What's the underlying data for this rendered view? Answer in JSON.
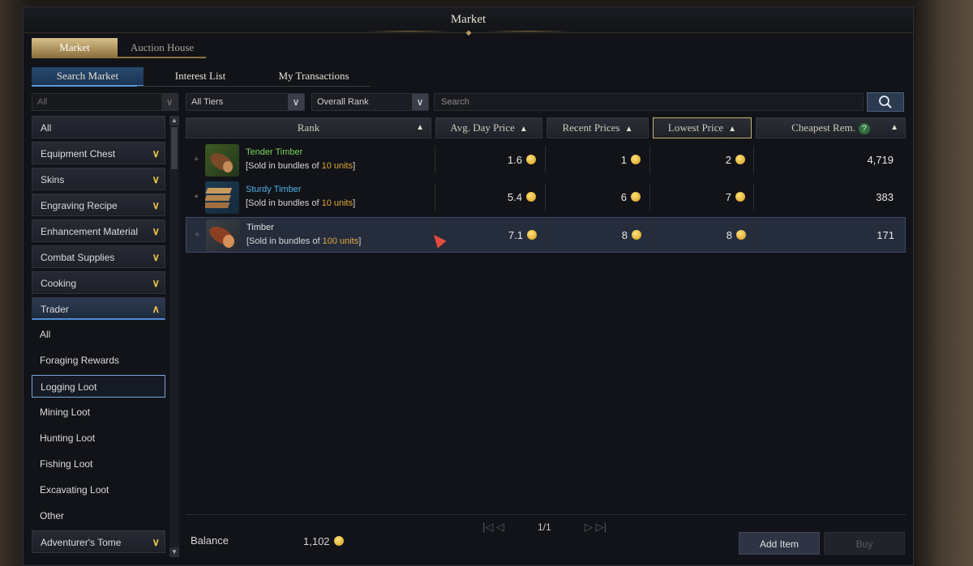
{
  "corner_label": "",
  "window": {
    "title": "Market"
  },
  "main_tabs": [
    "Market",
    "Auction House"
  ],
  "sub_tabs": [
    "Search Market",
    "Interest List",
    "My Transactions"
  ],
  "filters": {
    "category": "All",
    "tier": "All Tiers",
    "rank": "Overall Rank",
    "search_placeholder": "Search"
  },
  "sidebar": [
    {
      "label": "All"
    },
    {
      "label": "Equipment Chest"
    },
    {
      "label": "Skins"
    },
    {
      "label": "Engraving Recipe"
    },
    {
      "label": "Enhancement Material"
    },
    {
      "label": "Combat Supplies"
    },
    {
      "label": "Cooking"
    },
    {
      "label": "Trader"
    },
    {
      "label": "All"
    },
    {
      "label": "Foraging Rewards"
    },
    {
      "label": "Logging Loot"
    },
    {
      "label": "Mining Loot"
    },
    {
      "label": "Hunting Loot"
    },
    {
      "label": "Fishing Loot"
    },
    {
      "label": "Excavating Loot"
    },
    {
      "label": "Other"
    },
    {
      "label": "Adventurer's Tome"
    }
  ],
  "selected_category": "Logging Loot",
  "columns": [
    "Rank",
    "Avg. Day Price",
    "Recent Prices",
    "Lowest Price",
    "Cheapest Rem."
  ],
  "items": [
    {
      "name": "Tender Timber",
      "desc_prefix": "[Sold in bundles of ",
      "bundle": "10 units",
      "desc_suffix": "]",
      "avg_day_price": "1.6",
      "recent_price": "1",
      "lowest_price": "2",
      "cheapest_rem": "4,719",
      "name_color": "#7cd35a"
    },
    {
      "name": "Sturdy Timber",
      "desc_prefix": "[Sold in bundles of ",
      "bundle": "10 units",
      "desc_suffix": "]",
      "avg_day_price": "5.4",
      "recent_price": "6",
      "lowest_price": "7",
      "cheapest_rem": "383",
      "name_color": "#4fb2e6"
    },
    {
      "name": "Timber",
      "desc_prefix": "[Sold in bundles of ",
      "bundle": "100 units",
      "desc_suffix": "]",
      "avg_day_price": "7.1",
      "recent_price": "8",
      "lowest_price": "8",
      "cheapest_rem": "171",
      "name_color": "#e0e0e0"
    }
  ],
  "pagination": {
    "page": "1/1"
  },
  "footer": {
    "balance_label": "Balance",
    "balance_value": "1,102",
    "add_item": "Add Item",
    "buy": "Buy"
  },
  "colors": {
    "accent_gold": "#c9b06a",
    "accent_blue": "#4e8bd4",
    "bundle_orange": "#e0a638",
    "coin": "#e8b830"
  }
}
